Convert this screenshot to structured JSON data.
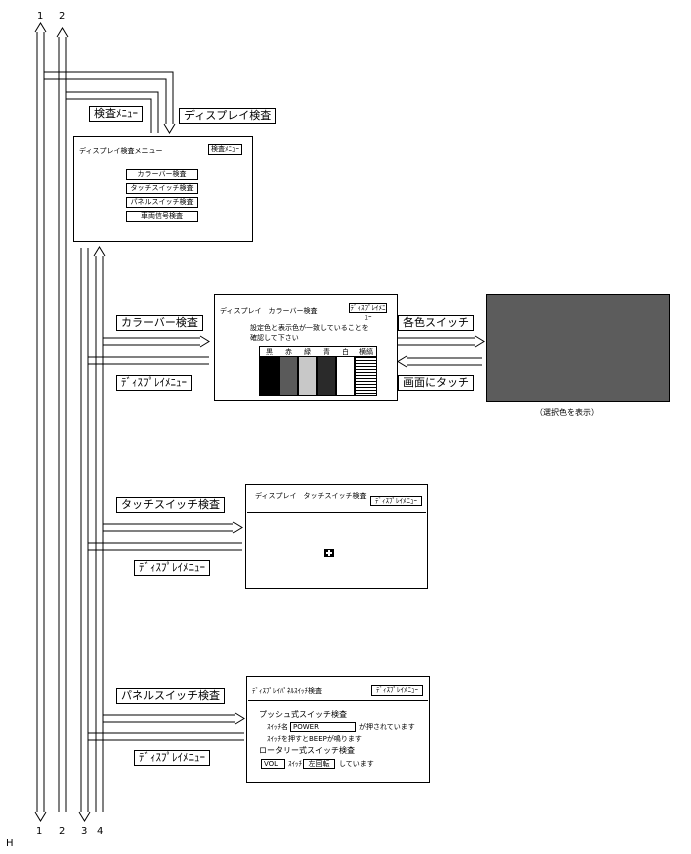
{
  "lanes": {
    "top": [
      "1",
      "2"
    ],
    "bottom": [
      "1",
      "2",
      "3",
      "4"
    ]
  },
  "corner_label": "H",
  "labels": {
    "kensa_menu": "検査ﾒﾆｭｰ",
    "display_kensa": "ディスプレイ検査",
    "color_bar_kensa": "カラーバー検査",
    "display_menu_1": "ﾃﾞｨｽﾌﾟﾚｲﾒﾆｭｰ",
    "kakushoku_switch": "各色スイッチ",
    "gamen_ni_touch": "画面にタッチ",
    "touch_switch_kensa": "タッチスイッチ検査",
    "display_menu_2": "ﾃﾞｨｽﾌﾟﾚｲﾒﾆｭｰ",
    "panel_switch_kensa": "パネルスイッチ検査",
    "display_menu_3": "ﾃﾞｨｽﾌﾟﾚｲﾒﾆｭｰ"
  },
  "screen_menu": {
    "title": "ディスプレイ検査メニュー",
    "corner_button": "検査ﾒﾆｭｰ",
    "buttons": [
      "カラーバー検査",
      "タッチスイッチ検査",
      "パネルスイッチ検査",
      "車両信号検査"
    ]
  },
  "screen_colorbar": {
    "title": "ディスプレイ　カラーバー検査",
    "corner_button": "ﾃﾞｨｽﾌﾟﾚｲﾒﾆｭｰ",
    "line1": "設定色と表示色が一致していることを",
    "line2": "確認して下さい",
    "columns": [
      "黒",
      "赤",
      "緑",
      "青",
      "白",
      "横縞"
    ],
    "colors": {
      "black": "#000000",
      "red": "#5a5a5a",
      "green": "#c8c8c8",
      "blue": "#2a2a2a",
      "white": "#ffffff"
    }
  },
  "screen_selected": {
    "fill": "#5c5c5c",
    "caption": "（選択色を表示）"
  },
  "screen_touch": {
    "title": "ディスプレイ　タッチスイッチ検査",
    "corner_button": "ﾃﾞｨｽﾌﾟﾚｲﾒﾆｭｰ"
  },
  "screen_panel": {
    "title": "ﾃﾞｨｽﾌﾟﾚｲﾊﾟﾈﾙｽｲｯﾁ検査",
    "corner_button": "ﾃﾞｨｽﾌﾟﾚｲﾒﾆｭｰ",
    "push_heading": "プッシュ式スイッチ検査",
    "switch_name_label": "ｽｲｯﾁ名",
    "switch_name_value": "POWER",
    "pressed_text": "が押されています",
    "beep_text": "ｽｲｯﾁを押すとBEEPが鳴ります",
    "rotary_heading": "ロータリー式スイッチ検査",
    "vol_value": "VOL",
    "switch_word": "ｽｲｯﾁ",
    "direction_value": "左回転",
    "doing_text": "しています"
  }
}
